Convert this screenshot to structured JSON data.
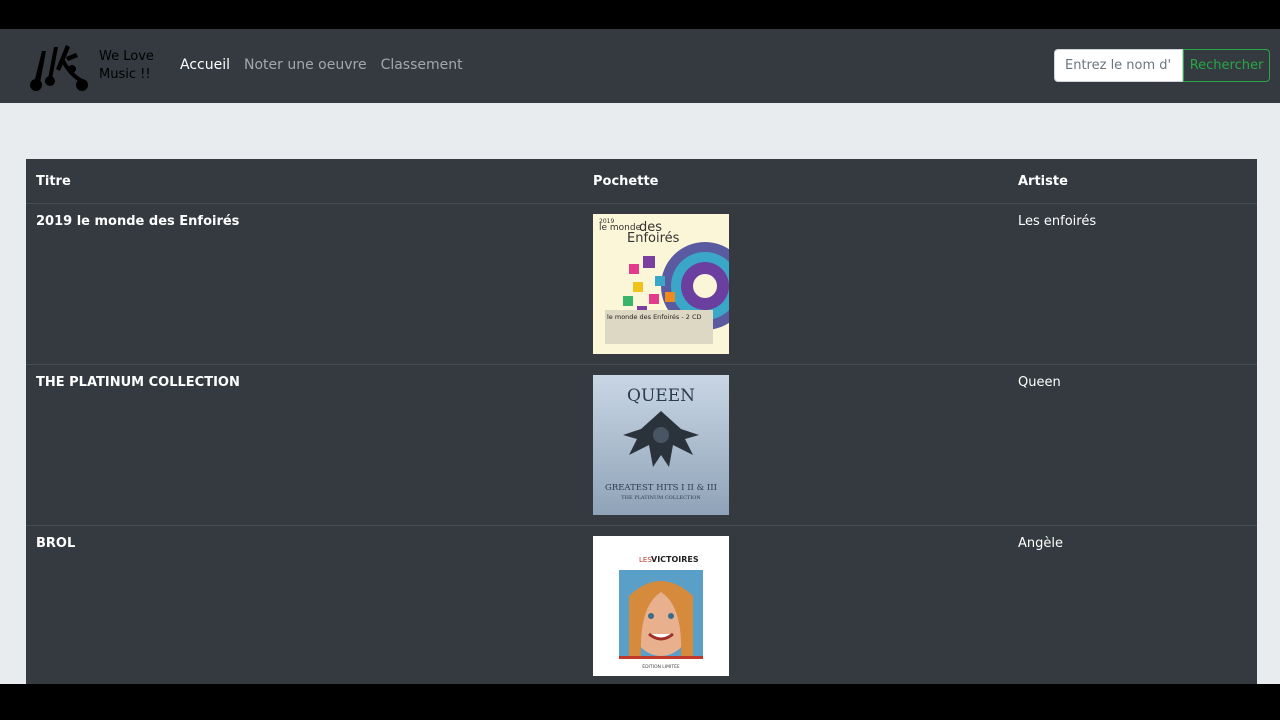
{
  "brand": {
    "text": "We Love Music !!"
  },
  "nav": [
    {
      "label": "Accueil",
      "active": true
    },
    {
      "label": "Noter une oeuvre",
      "active": false
    },
    {
      "label": "Classement",
      "active": false
    }
  ],
  "search": {
    "placeholder": "Entrez le nom d'un",
    "button": "Rechercher"
  },
  "table": {
    "headers": [
      "Titre",
      "Pochette",
      "Artiste"
    ],
    "rows": [
      {
        "title": "2019 le monde des Enfoirés",
        "artist": "Les enfoirés",
        "cover": "enfoires-cover"
      },
      {
        "title": "THE PLATINUM COLLECTION",
        "artist": "Queen",
        "cover": "queen-cover"
      },
      {
        "title": "BROL",
        "artist": "Angèle",
        "cover": "brol-cover"
      }
    ]
  },
  "covers": {
    "queen_title": "QUEEN",
    "queen_sub": "GREATEST HITS I II & III",
    "queen_sub2": "THE PLATINUM COLLECTION",
    "enfoires_small": "2019",
    "enfoires_line1": "le monde",
    "enfoires_line2": "des",
    "enfoires_line3": "Enfoirés",
    "enfoires_band": "le monde des Enfoirés - 2 CD",
    "brol_les": "LES",
    "brol_victoires": "VICTOIRES",
    "brol_edition": "ÉDITION LIMITÉE"
  },
  "colors": {
    "navbar": "#343a40",
    "page": "#e9ecef",
    "accent": "#28a745"
  }
}
